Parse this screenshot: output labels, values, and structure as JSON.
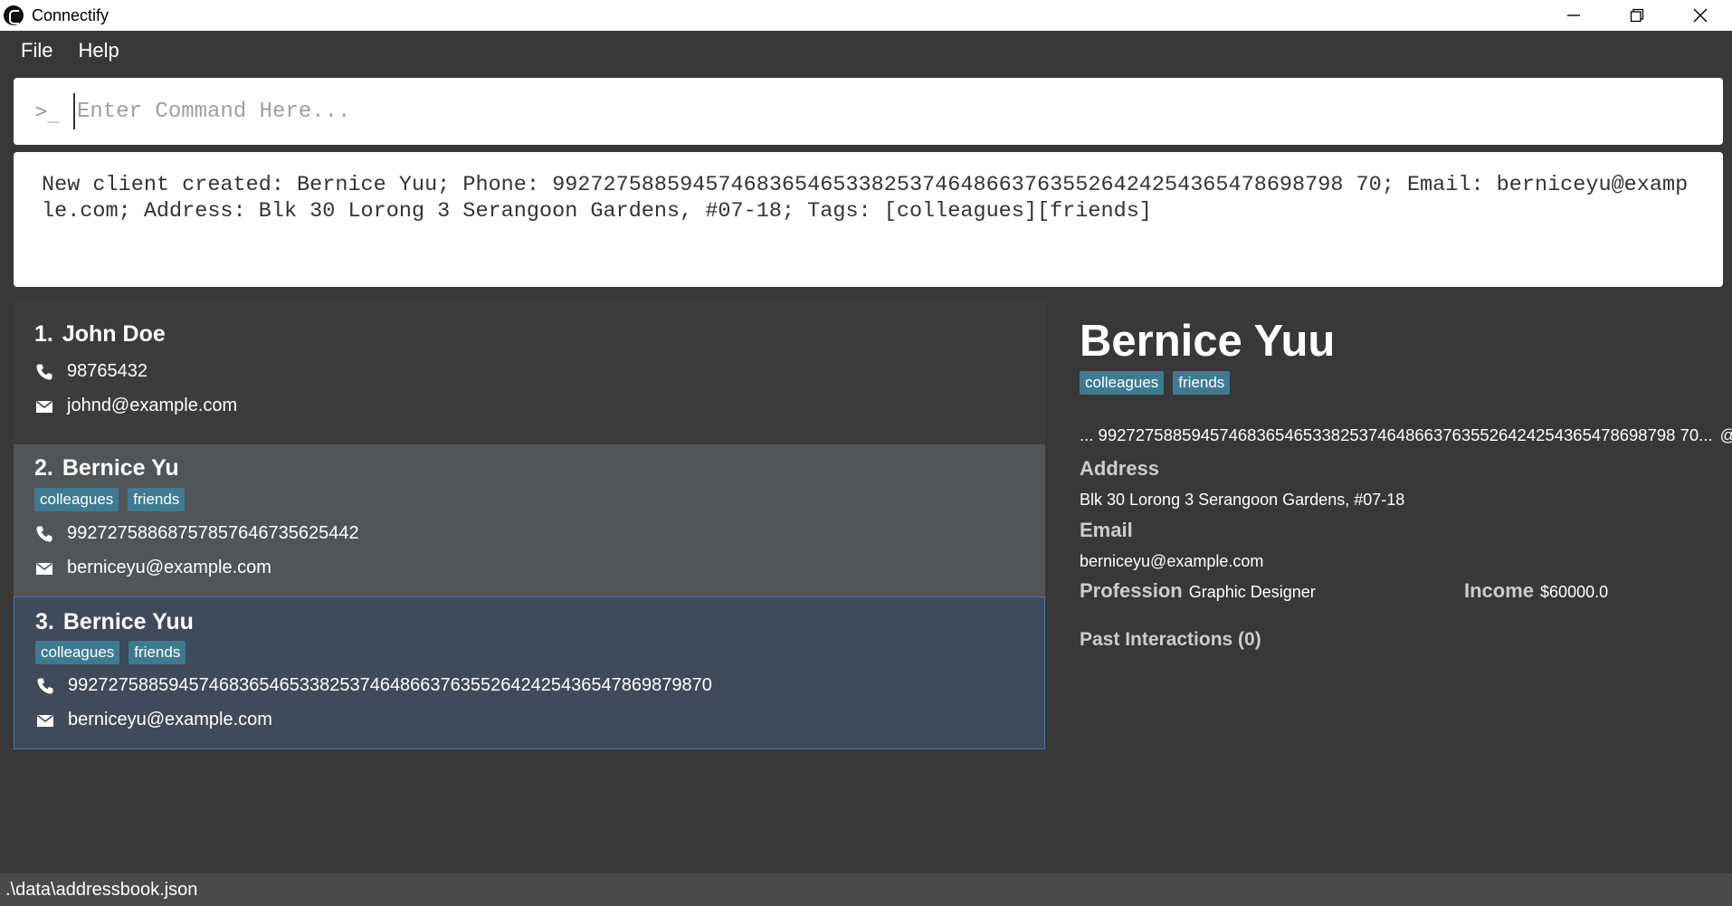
{
  "window": {
    "title": "Connectify",
    "controls": {
      "minimize": "minimize-icon",
      "restore": "restore-icon",
      "close": "close-icon"
    }
  },
  "menu": {
    "items": [
      "File",
      "Help"
    ]
  },
  "command": {
    "icon": ">_",
    "placeholder": "Enter Command Here...",
    "value": ""
  },
  "result": {
    "text": "New client created: Bernice Yuu; Phone: 99272758859457468365465338253746486637635526424254365478698798 70; Email: berniceyu@example.com; Address: Blk 30 Lorong 3 Serangoon Gardens, #07-18; Tags: [colleagues][friends]"
  },
  "clients": [
    {
      "index": "1.",
      "name": "John Doe",
      "tags": [],
      "phone": "98765432",
      "email": "johnd@example.com"
    },
    {
      "index": "2.",
      "name": "Bernice Yu",
      "tags": [
        "colleagues",
        "friends"
      ],
      "phone": "99272758868757857646735625442",
      "email": "berniceyu@example.com"
    },
    {
      "index": "3.",
      "name": "Bernice Yuu",
      "tags": [
        "colleagues",
        "friends"
      ],
      "phone": "9927275885945746836546533825374648663763552642425436547869879870",
      "email": "berniceyu@example.com"
    }
  ],
  "detail": {
    "name": "Bernice Yuu",
    "tags": [
      "colleagues",
      "friends"
    ],
    "phone_truncated": "... 99272758859457468365465338253746486637635526424254365478698798 70...",
    "handle": "@yuyu",
    "address_label": "Address",
    "address": "Blk 30 Lorong 3 Serangoon Gardens, #07-18",
    "email_label": "Email",
    "email": "berniceyu@example.com",
    "profession_label": "Profession",
    "profession": "Graphic Designer",
    "income_label": "Income",
    "income": "$60000.0",
    "past_interactions": "Past Interactions (0)"
  },
  "status": {
    "path": ".\\data\\addressbook.json"
  },
  "colors": {
    "background": "#383838",
    "tag": "#3e7b91",
    "selected_card": "#3f4a5a",
    "selected_border": "#3d7bb0"
  }
}
